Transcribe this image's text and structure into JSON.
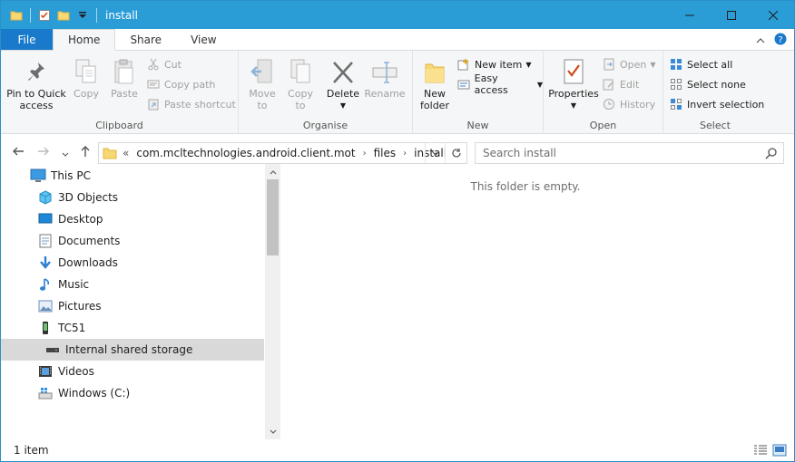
{
  "window": {
    "title": "install"
  },
  "tabs": {
    "file": "File",
    "home": "Home",
    "share": "Share",
    "view": "View"
  },
  "ribbon": {
    "clipboard": {
      "label": "Clipboard",
      "pin_line1": "Pin to Quick",
      "pin_line2": "access",
      "copy": "Copy",
      "paste": "Paste",
      "cut": "Cut",
      "copy_path": "Copy path",
      "paste_shortcut": "Paste shortcut"
    },
    "organise": {
      "label": "Organise",
      "move_line1": "Move",
      "move_line2": "to",
      "copy_line1": "Copy",
      "copy_line2": "to",
      "delete": "Delete",
      "rename": "Rename"
    },
    "new": {
      "label": "New",
      "folder_line1": "New",
      "folder_line2": "folder",
      "new_item": "New item",
      "easy_access": "Easy access"
    },
    "open": {
      "label": "Open",
      "properties": "Properties",
      "open": "Open",
      "edit": "Edit",
      "history": "History"
    },
    "select": {
      "label": "Select",
      "select_all": "Select all",
      "select_none": "Select none",
      "invert": "Invert selection"
    }
  },
  "address": {
    "overflow": "«",
    "crumbs": [
      "com.mcltechnologies.android.client.mot",
      "files",
      "install"
    ]
  },
  "search": {
    "placeholder": "Search install"
  },
  "tree": [
    {
      "label": "This PC",
      "icon": "pc-icon"
    },
    {
      "label": "3D Objects",
      "icon": "3d-objects-icon"
    },
    {
      "label": "Desktop",
      "icon": "desktop-icon"
    },
    {
      "label": "Documents",
      "icon": "documents-icon"
    },
    {
      "label": "Downloads",
      "icon": "downloads-icon"
    },
    {
      "label": "Music",
      "icon": "music-icon"
    },
    {
      "label": "Pictures",
      "icon": "pictures-icon"
    },
    {
      "label": "TC51",
      "icon": "phone-icon"
    },
    {
      "label": "Internal shared storage",
      "icon": "storage-icon"
    },
    {
      "label": "Videos",
      "icon": "videos-icon"
    },
    {
      "label": "Windows  (C:)",
      "icon": "drive-icon"
    }
  ],
  "main": {
    "empty_message": "This folder is empty."
  },
  "status": {
    "item_count": "1 item"
  },
  "colors": {
    "titlebar": "#2b9dd6",
    "file_tab": "#1979ca",
    "selection": "#d9d9d9"
  }
}
